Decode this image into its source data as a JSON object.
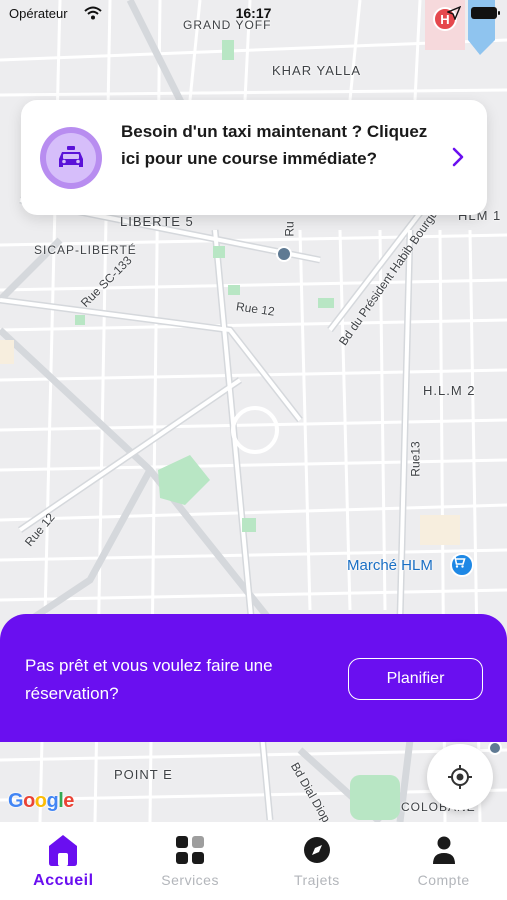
{
  "status_bar": {
    "carrier": "Opérateur",
    "time": "16:17"
  },
  "map": {
    "labels": {
      "grand_yoff": "GRAND YOFF",
      "khar_yalla": "KHAR YALLA",
      "liberte5": "LIBERTE 5",
      "sicap": "SICAP-LIBERTÉ",
      "hlm1": "HLM 1",
      "hlm2": "H.L.M 2",
      "point_e": "POINT E",
      "colobane": "COLOBANE"
    },
    "streets": {
      "rue_sc133": "Rue SC-133",
      "rue12a": "Rue 12",
      "rue12b": "Rue 12",
      "bd_president": "Bd du Président Habib Bourguiba",
      "rue13": "Rue13",
      "bd_dial_diop": "Bd Dial Diop",
      "rue_partial": "Ru"
    },
    "poi": {
      "marche_hlm": "Marché HLM"
    },
    "attribution": "Google"
  },
  "taxi_card": {
    "text": "Besoin d'un taxi maintenant ? Cliquez ici pour une course immédiate?",
    "icon": "taxi-icon"
  },
  "reservation": {
    "text": "Pas prêt et vous voulez faire une réservation?",
    "button_label": "Planifier"
  },
  "tabs": [
    {
      "label": "Accueil",
      "icon": "home-icon",
      "active": true
    },
    {
      "label": "Services",
      "icon": "grid-icon",
      "active": false
    },
    {
      "label": "Trajets",
      "icon": "compass-icon",
      "active": false
    },
    {
      "label": "Compte",
      "icon": "user-icon",
      "active": false
    }
  ],
  "colors": {
    "brand_purple": "#6a0ff0",
    "icon_bg": "#b88df0",
    "inactive_tab": "#b3b6bb"
  }
}
